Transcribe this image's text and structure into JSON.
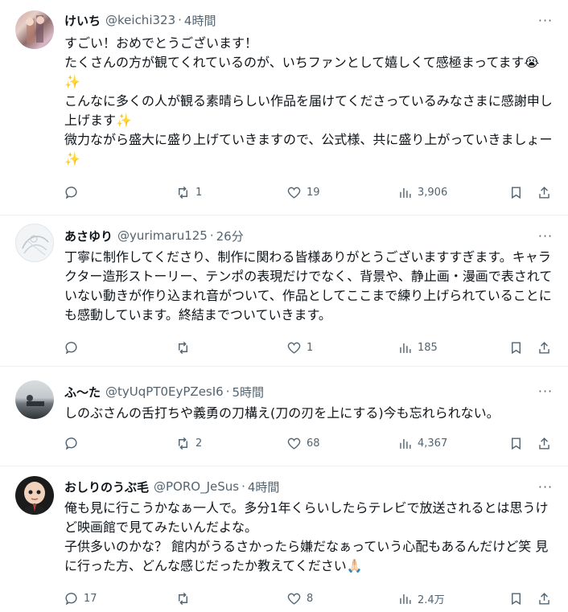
{
  "posts": [
    {
      "name": "けいち",
      "handle": "@keichi323",
      "time": "4時間",
      "text": "すごい！おめでとうございます！\nたくさんの方が観てくれているのが、いちファンとして嬉しくて感極まってます😭✨\nこんなに多くの人が観る素晴らしい作品を届けてくださっているみなさまに感謝申し上げます✨\n微力ながら盛大に盛り上げていきますので、公式様、共に盛り上がっていきましょー✨",
      "replies": "",
      "reposts": "1",
      "likes": "19",
      "views": "3,906"
    },
    {
      "name": "あさゆり",
      "handle": "@yurimaru125",
      "time": "26分",
      "text": "丁寧に制作してくださり、制作に関わる皆様ありがとうございますすぎます。キャラクター造形ストーリー、テンポの表現だけでなく、背景や、静止画・漫画で表されていない動きが作り込まれ音がついて、作品としてここまで練り上げられていることにも感動しています。終結までついていきます。",
      "replies": "",
      "reposts": "",
      "likes": "1",
      "views": "185"
    },
    {
      "name": "ふ〜た",
      "handle": "@tyUqPT0EyPZesI6",
      "time": "5時間",
      "text": "しのぶさんの舌打ちや義勇の刀構え(刀の刃を上にする)今も忘れられない。",
      "replies": "",
      "reposts": "2",
      "likes": "68",
      "views": "4,367"
    },
    {
      "name": "おしりのうぶ毛",
      "handle": "@PORO_JeSus",
      "time": "4時間",
      "text": "俺も見に行こうかなぁ一人で。多分1年くらいしたらテレビで放送されるとは思うけど映画館で見てみたいんだよな。\n子供多いのかな？ 館内がうるさかったら嫌だなぁっていう心配もあるんだけど笑 見に行った方、どんな感じだったか教えてください🙏🏻",
      "replies": "17",
      "reposts": "",
      "likes": "8",
      "views": "2.4万"
    }
  ],
  "ui": {
    "separator": "·",
    "more": "···"
  },
  "colors": {
    "text": "#0f1419",
    "muted": "#536471",
    "border": "#eff3f4"
  }
}
